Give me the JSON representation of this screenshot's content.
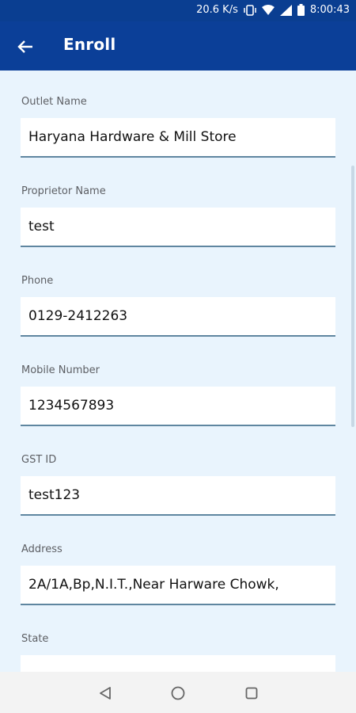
{
  "status_bar": {
    "net_speed": "20.6 K/s",
    "time": "8:00:43",
    "icons": [
      "vibrate-icon",
      "wifi-icon",
      "signal-icon",
      "battery-icon"
    ]
  },
  "app_bar": {
    "title": "Enroll",
    "back_icon": "arrow-back-icon"
  },
  "form": {
    "fields": [
      {
        "label": "Outlet Name",
        "value": "Haryana Hardware & Mill Store"
      },
      {
        "label": "Proprietor Name",
        "value": "test"
      },
      {
        "label": "Phone",
        "value": "0129-2412263"
      },
      {
        "label": "Mobile Number",
        "value": "1234567893"
      },
      {
        "label": "GST ID",
        "value": "test123"
      },
      {
        "label": "Address",
        "value": "2A/1A,Bp,N.I.T.,Near Harware Chowk,"
      },
      {
        "label": "State",
        "value": ""
      }
    ]
  },
  "nav_bar": {
    "icons": [
      "back-triangle-icon",
      "home-circle-icon",
      "recents-square-icon"
    ]
  },
  "colors": {
    "app_bar": "#0b3f98",
    "background": "#e9f4fd",
    "field_bg": "#ffffff",
    "underline": "#5f86a0"
  }
}
